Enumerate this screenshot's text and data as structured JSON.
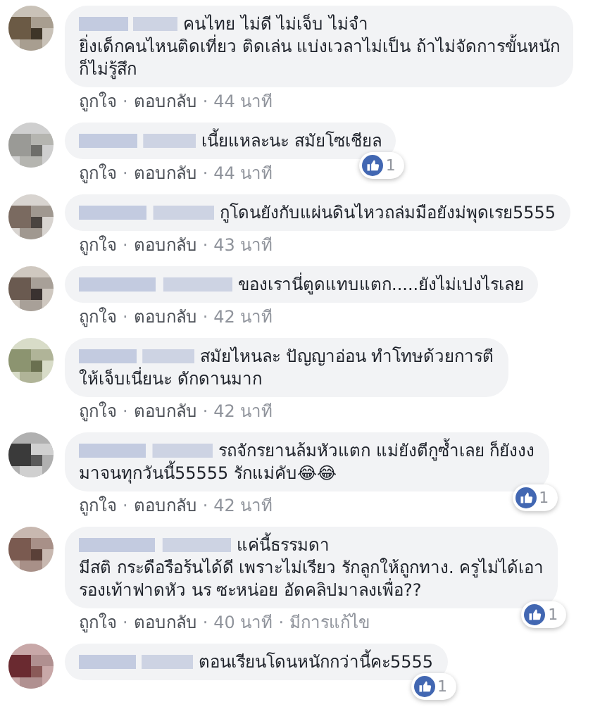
{
  "separator": "·",
  "comments": [
    {
      "lines": [
        "คนไทย ไม่ดี ไม่เจ็บ ไม่จำ",
        "ยิ่งเด็กคนไหนติดเที่ยว ติดเล่น แบ่งเวลาไม่เป็น ถ้าไม่จัดการขั้นหนัก",
        "ก็ไม่รู้สึก"
      ],
      "actions": [
        "ถูกใจ",
        "ตอบกลับ",
        "44 นาที"
      ]
    },
    {
      "lines": [
        "เนี้ยแหละนะ สมัยโซเชียล"
      ],
      "reactions": "1",
      "actions": [
        "ถูกใจ",
        "ตอบกลับ",
        "44 นาที"
      ]
    },
    {
      "lines": [
        "กูโดนยังกับแผ่นดินไหวถล่มมือยังม่พุดเรย5555"
      ],
      "actions": [
        "ถูกใจ",
        "ตอบกลับ",
        "43 นาที"
      ]
    },
    {
      "lines": [
        "ของเรานี่ตูดแทบแตก.....ยังไม่เปงไรเลย"
      ],
      "actions": [
        "ถูกใจ",
        "ตอบกลับ",
        "42 นาที"
      ]
    },
    {
      "lines": [
        "สมัยไหนละ ปัญญาอ่อน ทำโทษด้วยการตี",
        "ให้เจ็บเนี่ยนะ ดักดานมาก"
      ],
      "actions": [
        "ถูกใจ",
        "ตอบกลับ",
        "42 นาที"
      ]
    },
    {
      "lines": [
        "รถจักรยานล้มหัวแตก แม่ยังตีกูซ้ำเลย ก็ยังงง",
        "มาจนทุกวันนี้55555 รักแม่คับ😂😂"
      ],
      "reactions": "1",
      "actions": [
        "ถูกใจ",
        "ตอบกลับ",
        "42 นาที"
      ]
    },
    {
      "lines": [
        "แค่นี้ธรรมดา",
        "มีสติ กระดือรือร้นได้ดี เพราะไม่เรียว รักลูกให้ถูกทาง. ครูไม่ได้เอา",
        "รองเท้าฟาดหัว นร ซะหน่อย อัดคลิปมาลงเพื่อ??"
      ],
      "reactions": "1",
      "actions": [
        "ถูกใจ",
        "ตอบกลับ",
        "40 นาที",
        "มีการแก้ไข"
      ]
    },
    {
      "lines": [
        "ตอนเรียนโดนหนักกว่านี้คะ5555"
      ],
      "reactions": "1"
    }
  ]
}
